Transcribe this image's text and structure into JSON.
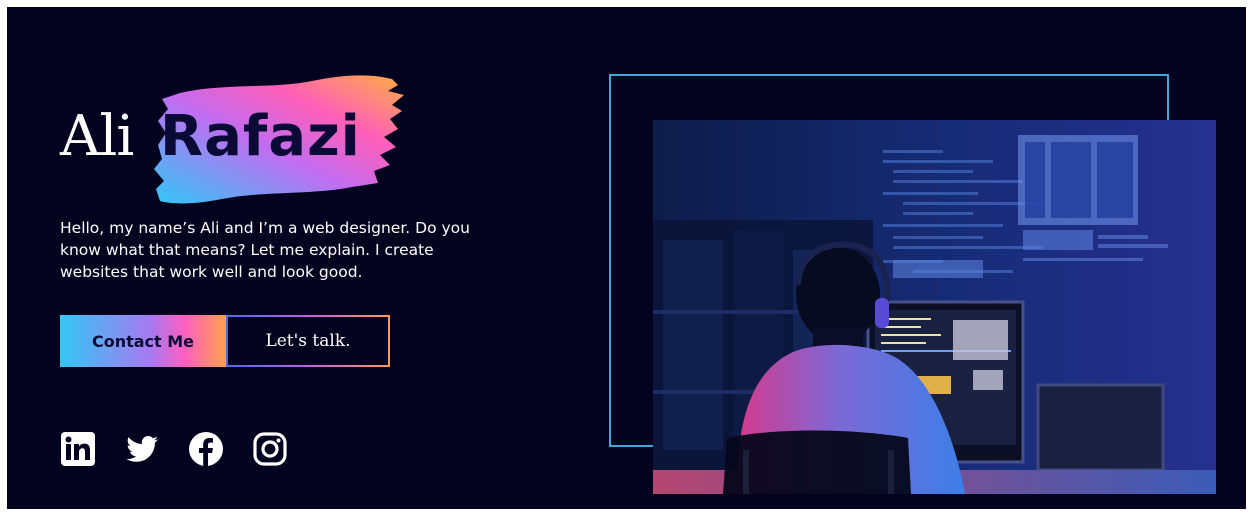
{
  "hero": {
    "first_name": "Ali",
    "last_name": "Rafazi",
    "intro": "Hello, my name’s Ali and I’m a web designer. Do you know what that means? Let me explain. I create websites that work well and look good.",
    "contact_label": "Contact Me",
    "talk_label": "Let's talk."
  },
  "social": [
    {
      "icon": "linkedin-icon"
    },
    {
      "icon": "twitter-icon"
    },
    {
      "icon": "facebook-icon"
    },
    {
      "icon": "instagram-icon"
    }
  ],
  "colors": {
    "background": "#03021f",
    "frame": "#3da7de",
    "gradient_start": "#33c8f4",
    "gradient_mid": "#ff5fc0",
    "gradient_end": "#ffa14e",
    "name_dark": "#0b0a36"
  }
}
